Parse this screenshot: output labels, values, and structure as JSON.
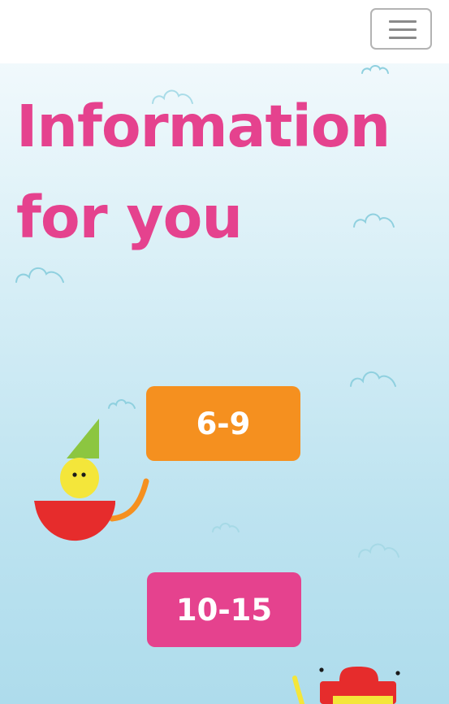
{
  "header": {
    "menu_icon": "hamburger-icon"
  },
  "hero": {
    "title_line1": "Information",
    "title_line2": "for you"
  },
  "age_groups": [
    {
      "label": "6-9",
      "color": "#f5901f"
    },
    {
      "label": "10-15",
      "color": "#e5428e"
    }
  ],
  "colors": {
    "title": "#e5428e",
    "sky_top": "#f1f9fc",
    "sky_bottom": "#aedcec",
    "cloud_outline": "#8fd0df"
  },
  "decorations": {
    "clouds": "cloud-icon",
    "characters": [
      "gnome-character",
      "red-hat-character"
    ]
  }
}
